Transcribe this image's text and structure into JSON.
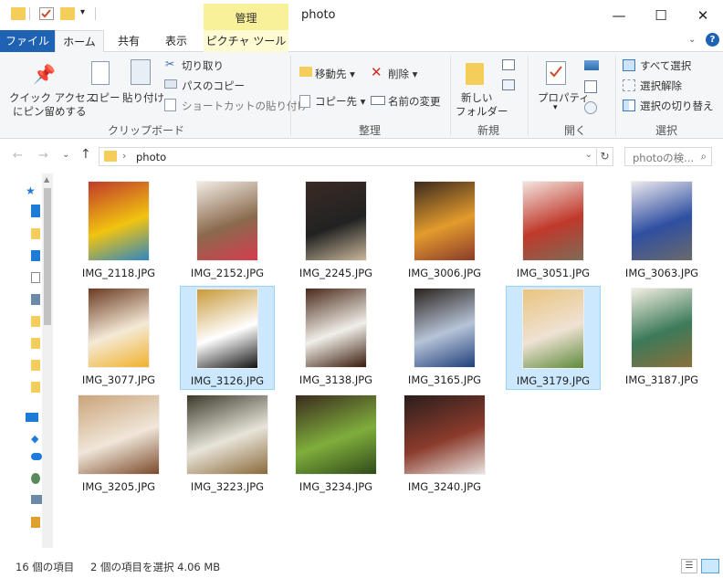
{
  "window": {
    "title": "photo",
    "context_tab_group": "管理",
    "minimize": "—",
    "maximize": "☐",
    "close": "✕"
  },
  "tabs": [
    "ファイル",
    "ホーム",
    "共有",
    "表示",
    "ピクチャ ツール"
  ],
  "ribbon": {
    "clipboard": {
      "pin_quick_access_line1": "クイック アクセス",
      "pin_quick_access_line2": "にピン留めする",
      "copy": "コピー",
      "paste": "貼り付け",
      "cut": "切り取り",
      "copy_path": "パスのコピー",
      "paste_shortcut": "ショートカットの貼り付け",
      "group_label": "クリップボード"
    },
    "organize": {
      "move_to": "移動先",
      "copy_to": "コピー先",
      "delete": "削除",
      "rename": "名前の変更",
      "group_label": "整理"
    },
    "new": {
      "new_folder_line1": "新しい",
      "new_folder_line2": "フォルダー",
      "group_label": "新規"
    },
    "open": {
      "properties": "プロパティ",
      "group_label": "開く"
    },
    "select": {
      "select_all": "すべて選択",
      "select_none": "選択解除",
      "invert_selection": "選択の切り替え",
      "group_label": "選択"
    }
  },
  "address": {
    "path": "photo",
    "search_placeholder": "photoの検..."
  },
  "files": [
    {
      "name": "IMG_2118.JPG",
      "selected": false,
      "colors": [
        "#c0392b",
        "#f1c40f",
        "#2e86c1"
      ]
    },
    {
      "name": "IMG_2152.JPG",
      "selected": false,
      "colors": [
        "#f2ece4",
        "#8a6a4d",
        "#d63c4f"
      ]
    },
    {
      "name": "IMG_2245.JPG",
      "selected": false,
      "colors": [
        "#3a2a24",
        "#222222",
        "#c9b79a"
      ]
    },
    {
      "name": "IMG_3006.JPG",
      "selected": false,
      "colors": [
        "#3b2a1d",
        "#e39b2d",
        "#8a3b2a"
      ]
    },
    {
      "name": "IMG_3051.JPG",
      "selected": false,
      "colors": [
        "#f3e4de",
        "#c0392b",
        "#7d6b57"
      ]
    },
    {
      "name": "IMG_3063.JPG",
      "selected": false,
      "colors": [
        "#ece9ee",
        "#2f4fa1",
        "#6a6a6a"
      ]
    },
    {
      "name": "IMG_3077.JPG",
      "selected": false,
      "colors": [
        "#6b3a22",
        "#f5ead7",
        "#f0b12b"
      ]
    },
    {
      "name": "IMG_3126.JPG",
      "selected": true,
      "colors": [
        "#c89a3a",
        "#ffffff",
        "#111111"
      ]
    },
    {
      "name": "IMG_3138.JPG",
      "selected": false,
      "colors": [
        "#4a2a1a",
        "#f1efe9",
        "#3a1a0a"
      ]
    },
    {
      "name": "IMG_3165.JPG",
      "selected": false,
      "colors": [
        "#2a221c",
        "#b7c4d8",
        "#1f3f7a"
      ]
    },
    {
      "name": "IMG_3179.JPG",
      "selected": true,
      "colors": [
        "#e9c47e",
        "#efe2d4",
        "#5d8a3a"
      ]
    },
    {
      "name": "IMG_3187.JPG",
      "selected": false,
      "colors": [
        "#f4efe2",
        "#3c7a5a",
        "#8a6f3b"
      ]
    },
    {
      "name": "IMG_3205.JPG",
      "selected": false,
      "colors": [
        "#caa47a",
        "#f0e6d9",
        "#7a4a2a"
      ]
    },
    {
      "name": "IMG_3223.JPG",
      "selected": false,
      "colors": [
        "#3b3a2a",
        "#e8e4da",
        "#8a6a3a"
      ]
    },
    {
      "name": "IMG_3234.JPG",
      "selected": false,
      "colors": [
        "#3a2b1e",
        "#7fae3c",
        "#2f4a1a"
      ]
    },
    {
      "name": "IMG_3240.JPG",
      "selected": false,
      "colors": [
        "#2a1e1c",
        "#8b3b2c",
        "#e8e4e0"
      ]
    }
  ],
  "status": {
    "item_count": "16 個の項目",
    "selection": "2 個の項目を選択  4.06 MB"
  }
}
